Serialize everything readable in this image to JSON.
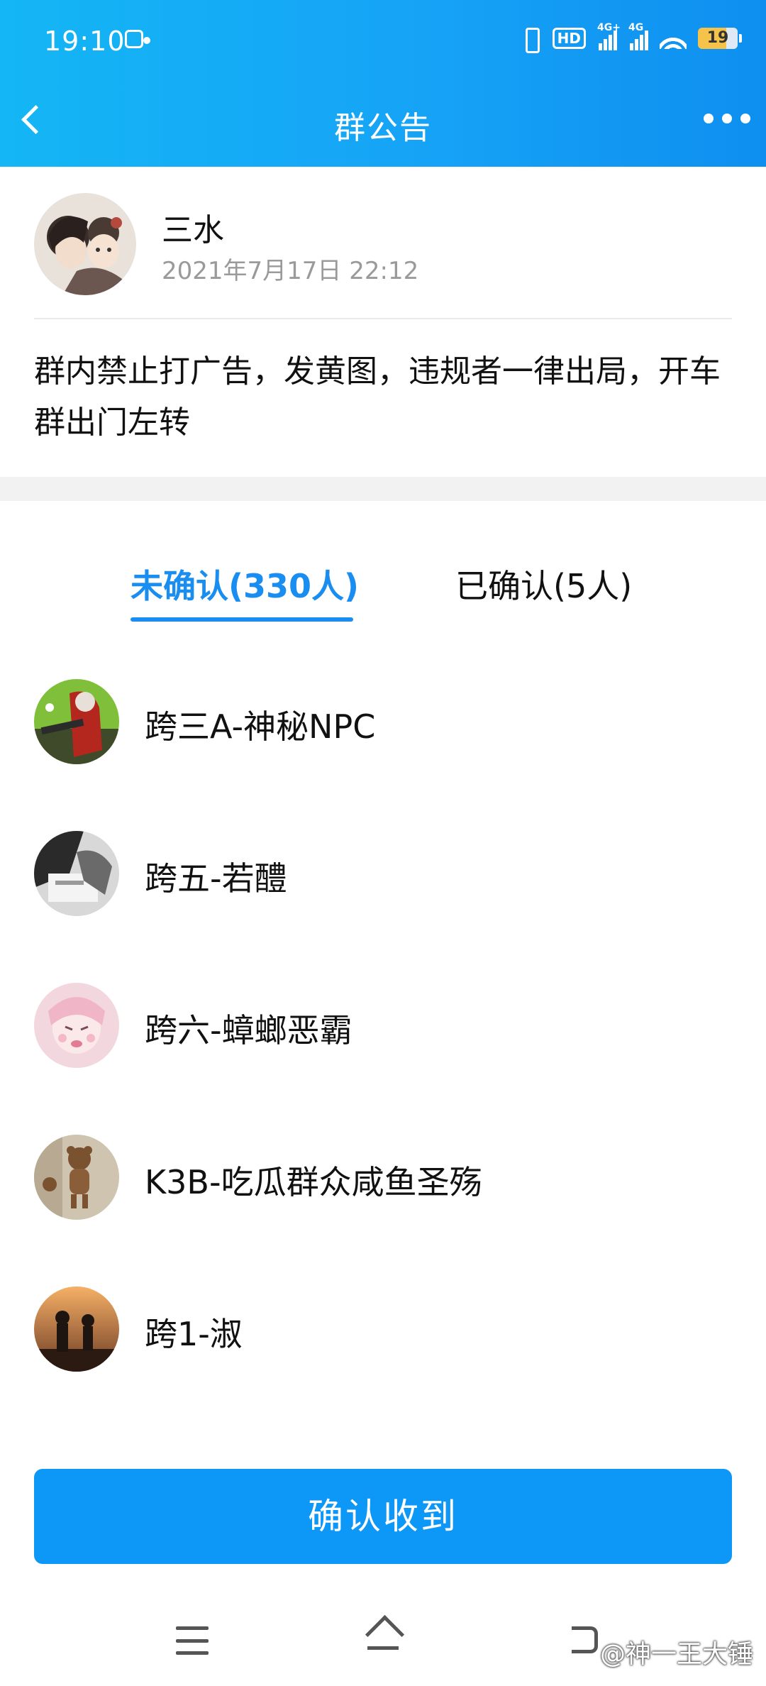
{
  "status_bar": {
    "time": "19:10",
    "hd_label": "HD",
    "net1": "4G+",
    "net2": "4G",
    "battery": "19"
  },
  "nav": {
    "title": "群公告",
    "back_icon": "chevron-left-icon",
    "more_icon": "more-dots-icon"
  },
  "announcement": {
    "author_name": "三水",
    "author_time": "2021年7月17日 22:12",
    "content": "群内禁止打广告，发黄图，违规者一律出局，开车群出门左转"
  },
  "tabs": {
    "unconfirmed": "未确认(330人)",
    "confirmed": "已确认(5人)"
  },
  "members": [
    {
      "name": "跨三A-神秘NPC"
    },
    {
      "name": "跨五-若醴"
    },
    {
      "name": "跨六-蟑螂恶霸"
    },
    {
      "name": "K3B-吃瓜群众咸鱼圣殇"
    },
    {
      "name": "跨1-淑"
    }
  ],
  "confirm_button": "确认收到",
  "watermark": "@神一王大锤",
  "colors": {
    "accent": "#1a8ef0",
    "button": "#0d97f7",
    "header_gradient_start": "#14b6f5",
    "header_gradient_end": "#0e8ff0"
  }
}
